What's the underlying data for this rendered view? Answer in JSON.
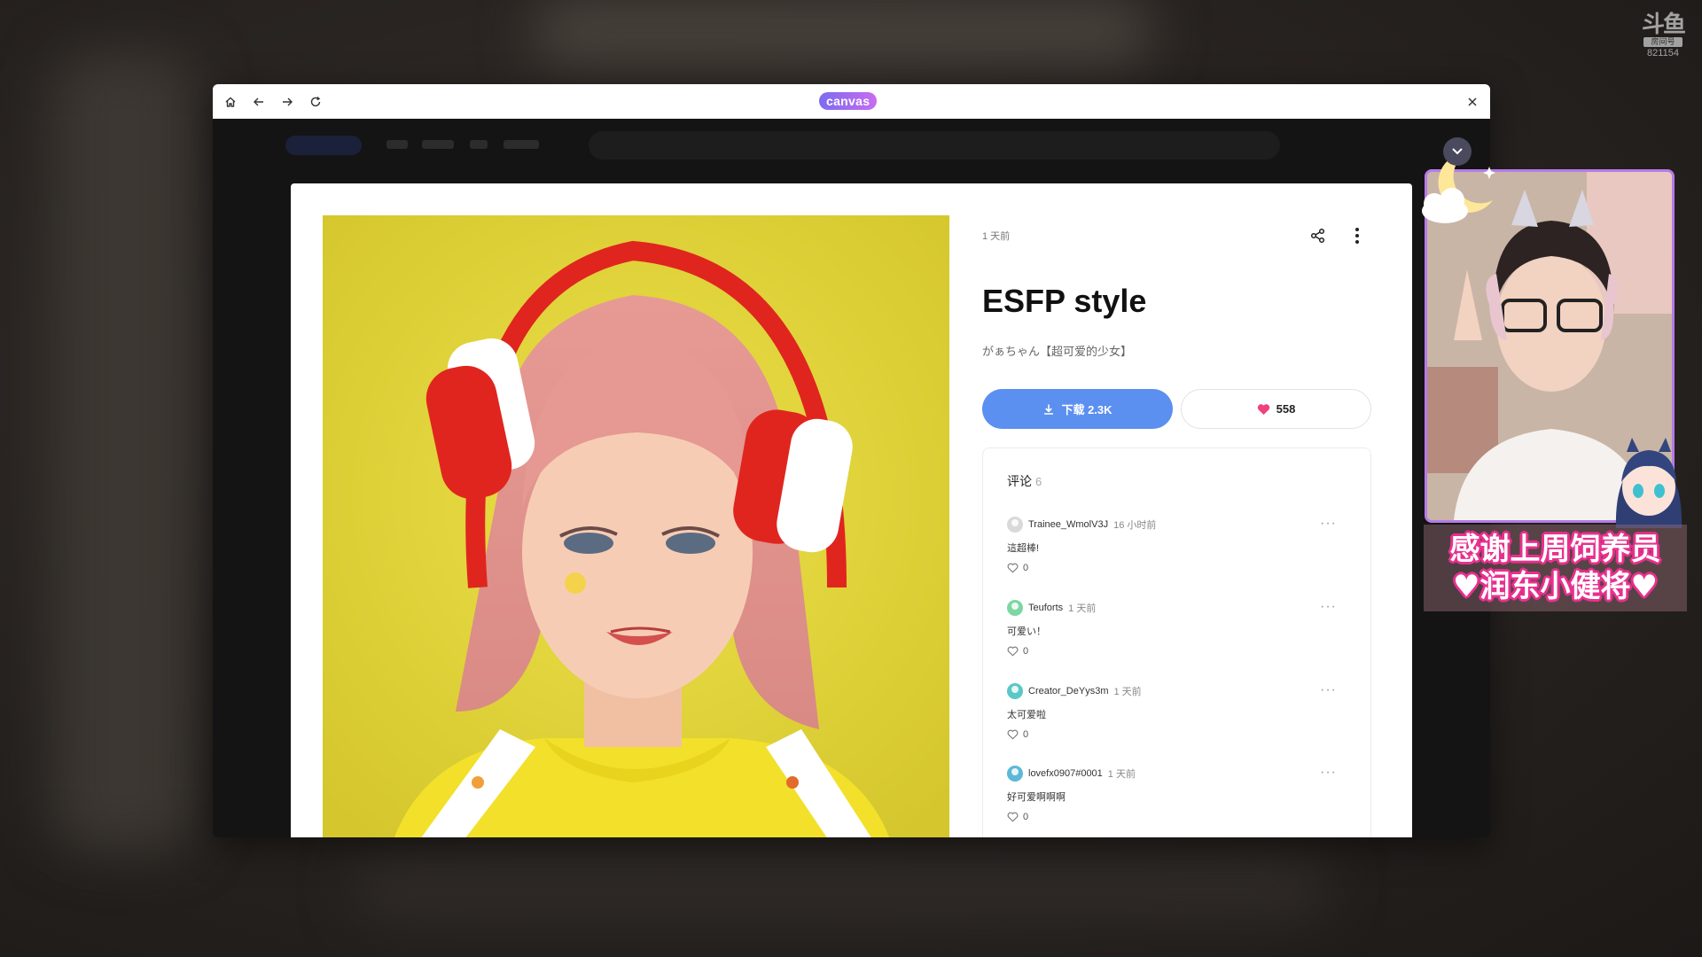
{
  "watermark": {
    "logo": "斗鱼",
    "tag": "房间号",
    "room": "821154"
  },
  "browser": {
    "logo": "canvas"
  },
  "post": {
    "time_ago": "1 天前",
    "title": "ESFP style",
    "author": "がぁちゃん【超可爱的少女】",
    "download_label": "下载 2.3K",
    "like_count": "558"
  },
  "comments": {
    "header": "评论",
    "count": "6",
    "items": [
      {
        "user": "Trainee_WmolV3J",
        "time": "16 小时前",
        "text": "這超棒!",
        "likes": "0",
        "avatar_color": "#d9d9d9"
      },
      {
        "user": "Teuforts",
        "time": "1 天前",
        "text": "可爱い！",
        "likes": "0",
        "avatar_color": "#7ed6a1"
      },
      {
        "user": "Creator_DeYys3m",
        "time": "1 天前",
        "text": "太可爱啦",
        "likes": "0",
        "avatar_color": "#5cc7c7"
      },
      {
        "user": "lovefx0907#0001",
        "time": "1 天前",
        "text": "好可爱啊啊啊",
        "likes": "0",
        "avatar_color": "#5cb8d6"
      }
    ]
  },
  "stream": {
    "banner_line1": "感谢上周饲养员",
    "banner_line2": "♥润东小健将♥"
  },
  "colors": {
    "accent": "#5b8ff0",
    "heart": "#f0417a",
    "frame": "#b67be8",
    "banner_stroke": "#e8308f"
  }
}
